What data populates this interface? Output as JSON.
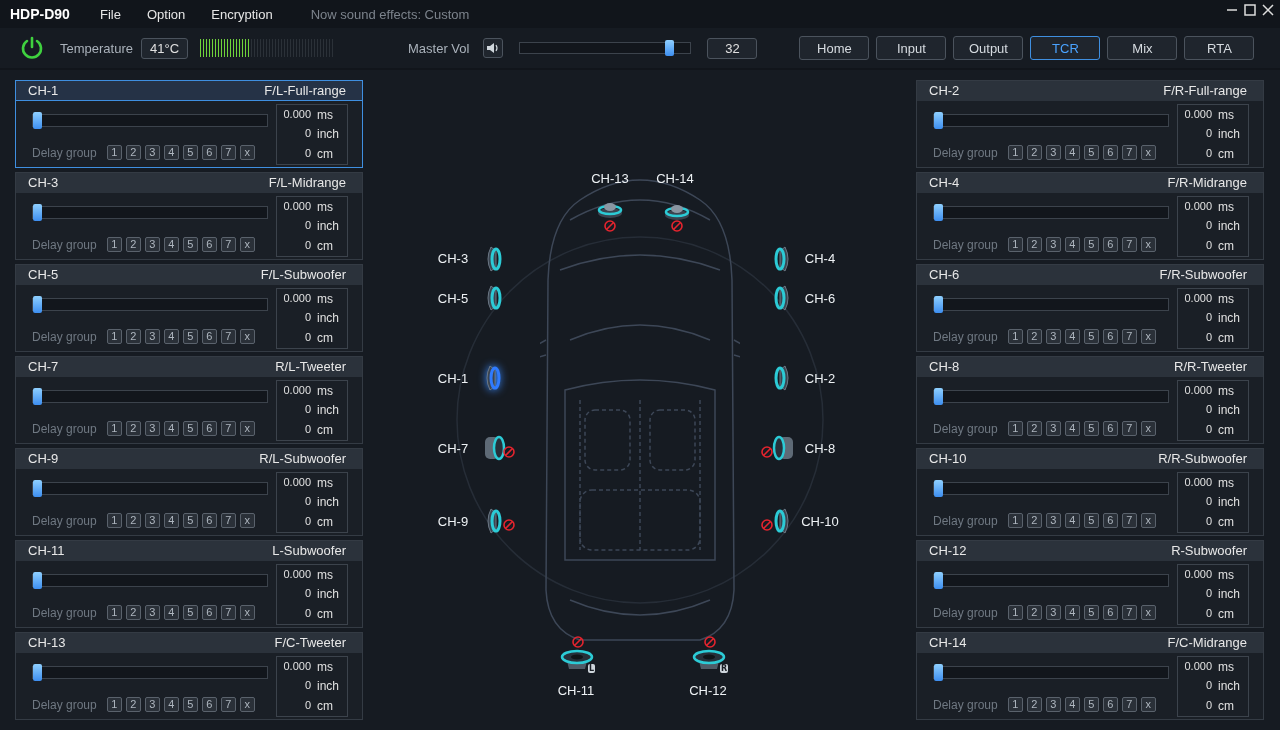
{
  "app": {
    "title": "HDP-D90",
    "menu": [
      "File",
      "Option",
      "Encryption"
    ],
    "status": "Now sound effects: Custom"
  },
  "toolbar": {
    "power_on": true,
    "temperature_label": "Temperature",
    "temperature": "41°C",
    "temperature_meter": {
      "level": 0.38
    },
    "master_vol_label": "Master Vol",
    "muted": false,
    "volume": {
      "level": 0.9
    },
    "volume_value": "32",
    "nav": [
      {
        "label": "Home",
        "selected": false
      },
      {
        "label": "Input",
        "selected": false
      },
      {
        "label": "Output",
        "selected": false
      },
      {
        "label": "TCR",
        "selected": true
      },
      {
        "label": "Mix",
        "selected": false
      },
      {
        "label": "RTA",
        "selected": false
      }
    ]
  },
  "left_channels": [
    {
      "channel": "CH-1",
      "role": "F/L-Full-range",
      "selected": true,
      "level": 0,
      "delay_label": "Delay group",
      "groups": [
        "1",
        "2",
        "3",
        "4",
        "5",
        "6",
        "7",
        "x"
      ],
      "readings": [
        {
          "value": "0.000",
          "unit": "ms"
        },
        {
          "value": "0",
          "unit": "inch"
        },
        {
          "value": "0",
          "unit": "cm"
        }
      ]
    },
    {
      "channel": "CH-3",
      "role": "F/L-Midrange",
      "selected": false,
      "level": 0,
      "delay_label": "Delay group",
      "groups": [
        "1",
        "2",
        "3",
        "4",
        "5",
        "6",
        "7",
        "x"
      ],
      "readings": [
        {
          "value": "0.000",
          "unit": "ms"
        },
        {
          "value": "0",
          "unit": "inch"
        },
        {
          "value": "0",
          "unit": "cm"
        }
      ]
    },
    {
      "channel": "CH-5",
      "role": "F/L-Subwoofer",
      "selected": false,
      "level": 0,
      "delay_label": "Delay group",
      "groups": [
        "1",
        "2",
        "3",
        "4",
        "5",
        "6",
        "7",
        "x"
      ],
      "readings": [
        {
          "value": "0.000",
          "unit": "ms"
        },
        {
          "value": "0",
          "unit": "inch"
        },
        {
          "value": "0",
          "unit": "cm"
        }
      ]
    },
    {
      "channel": "CH-7",
      "role": "R/L-Tweeter",
      "selected": false,
      "level": 0,
      "delay_label": "Delay group",
      "groups": [
        "1",
        "2",
        "3",
        "4",
        "5",
        "6",
        "7",
        "x"
      ],
      "readings": [
        {
          "value": "0.000",
          "unit": "ms"
        },
        {
          "value": "0",
          "unit": "inch"
        },
        {
          "value": "0",
          "unit": "cm"
        }
      ]
    },
    {
      "channel": "CH-9",
      "role": "R/L-Subwoofer",
      "selected": false,
      "level": 0,
      "delay_label": "Delay group",
      "groups": [
        "1",
        "2",
        "3",
        "4",
        "5",
        "6",
        "7",
        "x"
      ],
      "readings": [
        {
          "value": "0.000",
          "unit": "ms"
        },
        {
          "value": "0",
          "unit": "inch"
        },
        {
          "value": "0",
          "unit": "cm"
        }
      ]
    },
    {
      "channel": "CH-11",
      "role": "L-Subwoofer",
      "selected": false,
      "level": 0,
      "delay_label": "Delay group",
      "groups": [
        "1",
        "2",
        "3",
        "4",
        "5",
        "6",
        "7",
        "x"
      ],
      "readings": [
        {
          "value": "0.000",
          "unit": "ms"
        },
        {
          "value": "0",
          "unit": "inch"
        },
        {
          "value": "0",
          "unit": "cm"
        }
      ]
    },
    {
      "channel": "CH-13",
      "role": "F/C-Tweeter",
      "selected": false,
      "level": 0,
      "delay_label": "Delay group",
      "groups": [
        "1",
        "2",
        "3",
        "4",
        "5",
        "6",
        "7",
        "x"
      ],
      "readings": [
        {
          "value": "0.000",
          "unit": "ms"
        },
        {
          "value": "0",
          "unit": "inch"
        },
        {
          "value": "0",
          "unit": "cm"
        }
      ]
    }
  ],
  "right_channels": [
    {
      "channel": "CH-2",
      "role": "F/R-Full-range",
      "selected": false,
      "level": 0,
      "delay_label": "Delay group",
      "groups": [
        "1",
        "2",
        "3",
        "4",
        "5",
        "6",
        "7",
        "x"
      ],
      "readings": [
        {
          "value": "0.000",
          "unit": "ms"
        },
        {
          "value": "0",
          "unit": "inch"
        },
        {
          "value": "0",
          "unit": "cm"
        }
      ]
    },
    {
      "channel": "CH-4",
      "role": "F/R-Midrange",
      "selected": false,
      "level": 0,
      "delay_label": "Delay group",
      "groups": [
        "1",
        "2",
        "3",
        "4",
        "5",
        "6",
        "7",
        "x"
      ],
      "readings": [
        {
          "value": "0.000",
          "unit": "ms"
        },
        {
          "value": "0",
          "unit": "inch"
        },
        {
          "value": "0",
          "unit": "cm"
        }
      ]
    },
    {
      "channel": "CH-6",
      "role": "F/R-Subwoofer",
      "selected": false,
      "level": 0,
      "delay_label": "Delay group",
      "groups": [
        "1",
        "2",
        "3",
        "4",
        "5",
        "6",
        "7",
        "x"
      ],
      "readings": [
        {
          "value": "0.000",
          "unit": "ms"
        },
        {
          "value": "0",
          "unit": "inch"
        },
        {
          "value": "0",
          "unit": "cm"
        }
      ]
    },
    {
      "channel": "CH-8",
      "role": "R/R-Tweeter",
      "selected": false,
      "level": 0,
      "delay_label": "Delay group",
      "groups": [
        "1",
        "2",
        "3",
        "4",
        "5",
        "6",
        "7",
        "x"
      ],
      "readings": [
        {
          "value": "0.000",
          "unit": "ms"
        },
        {
          "value": "0",
          "unit": "inch"
        },
        {
          "value": "0",
          "unit": "cm"
        }
      ]
    },
    {
      "channel": "CH-10",
      "role": "R/R-Subwoofer",
      "selected": false,
      "level": 0,
      "delay_label": "Delay group",
      "groups": [
        "1",
        "2",
        "3",
        "4",
        "5",
        "6",
        "7",
        "x"
      ],
      "readings": [
        {
          "value": "0.000",
          "unit": "ms"
        },
        {
          "value": "0",
          "unit": "inch"
        },
        {
          "value": "0",
          "unit": "cm"
        }
      ]
    },
    {
      "channel": "CH-12",
      "role": "R-Subwoofer",
      "selected": false,
      "level": 0,
      "delay_label": "Delay group",
      "groups": [
        "1",
        "2",
        "3",
        "4",
        "5",
        "6",
        "7",
        "x"
      ],
      "readings": [
        {
          "value": "0.000",
          "unit": "ms"
        },
        {
          "value": "0",
          "unit": "inch"
        },
        {
          "value": "0",
          "unit": "cm"
        }
      ]
    },
    {
      "channel": "CH-14",
      "role": "F/C-Midrange",
      "selected": false,
      "level": 0,
      "delay_label": "Delay group",
      "groups": [
        "1",
        "2",
        "3",
        "4",
        "5",
        "6",
        "7",
        "x"
      ],
      "readings": [
        {
          "value": "0.000",
          "unit": "ms"
        },
        {
          "value": "0",
          "unit": "inch"
        },
        {
          "value": "0",
          "unit": "cm"
        }
      ]
    }
  ],
  "stage": {
    "speakers": [
      {
        "label": "CH-13",
        "kind": "dome",
        "muted": true,
        "active": false
      },
      {
        "label": "CH-14",
        "kind": "dome",
        "muted": true,
        "active": false
      },
      {
        "label": "CH-3",
        "kind": "side",
        "muted": false,
        "active": false
      },
      {
        "label": "CH-5",
        "kind": "side",
        "muted": false,
        "active": false
      },
      {
        "label": "CH-1",
        "kind": "side",
        "muted": false,
        "active": true
      },
      {
        "label": "CH-7",
        "kind": "woofer",
        "muted": true,
        "active": false
      },
      {
        "label": "CH-9",
        "kind": "side",
        "muted": true,
        "active": false
      },
      {
        "label": "CH-4",
        "kind": "side",
        "muted": false,
        "active": false
      },
      {
        "label": "CH-6",
        "kind": "side",
        "muted": false,
        "active": false
      },
      {
        "label": "CH-2",
        "kind": "side",
        "muted": false,
        "active": false
      },
      {
        "label": "CH-8",
        "kind": "woofer",
        "muted": true,
        "active": false
      },
      {
        "label": "CH-10",
        "kind": "side",
        "muted": true,
        "active": false
      },
      {
        "label": "CH-11",
        "kind": "bass",
        "badge": "L",
        "muted": true,
        "active": false
      },
      {
        "label": "CH-12",
        "kind": "bass",
        "badge": "R",
        "muted": true,
        "active": false
      }
    ]
  }
}
